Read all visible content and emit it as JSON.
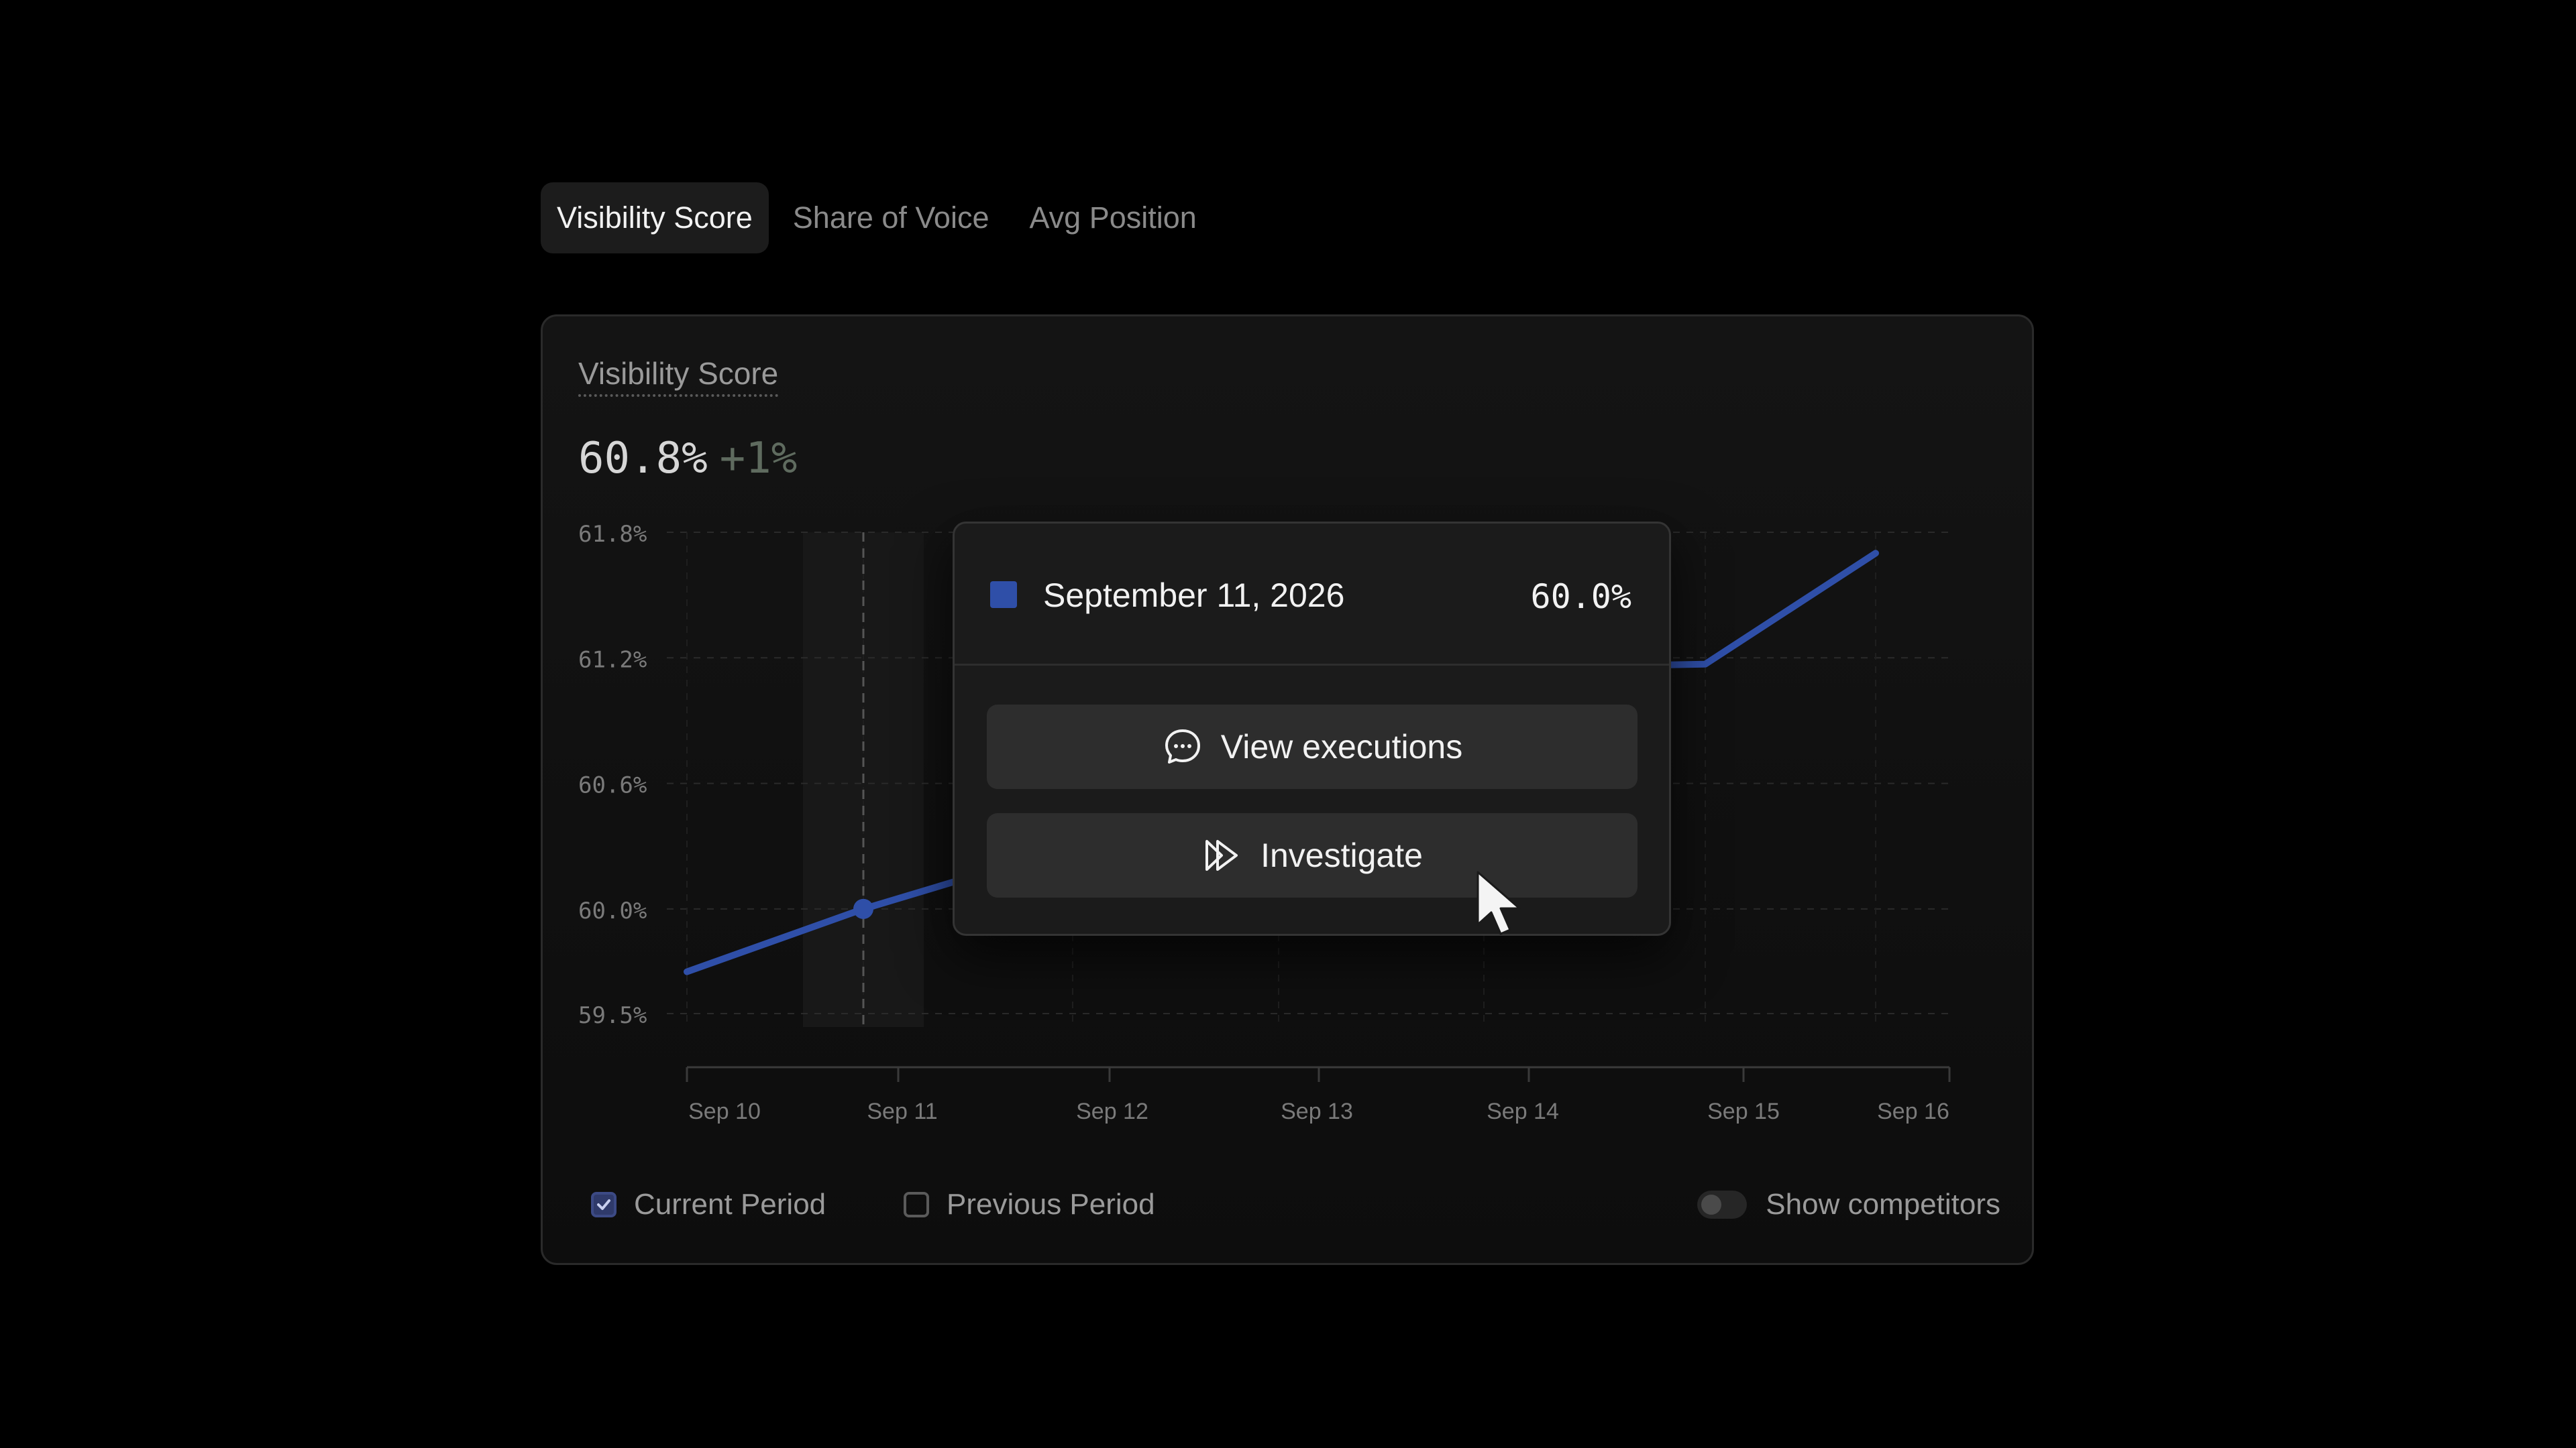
{
  "tabs": [
    {
      "label": "Visibility Score",
      "active": true
    },
    {
      "label": "Share of Voice",
      "active": false
    },
    {
      "label": "Avg Position",
      "active": false
    }
  ],
  "card": {
    "title": "Visibility Score",
    "value": "60.8%",
    "delta": "+1%"
  },
  "chart_data": {
    "type": "line",
    "categories": [
      "Sep 10",
      "Sep 11",
      "Sep 12",
      "Sep 13",
      "Sep 14",
      "Sep 15",
      "Sep 16"
    ],
    "yticks": [
      "61.8%",
      "61.2%",
      "60.6%",
      "60.0%",
      "59.5%"
    ],
    "ylim": [
      59.5,
      61.8
    ],
    "series": [
      {
        "color": "#2f4fa8",
        "x": [
          "Sep 10",
          "Sep 11",
          "Sep 12",
          "Sep 13",
          "Sep 14",
          "Sep 15",
          "Sep 16"
        ],
        "values": [
          59.7,
          60.0,
          60.3,
          60.7,
          61.15,
          61.17,
          61.7
        ]
      }
    ],
    "highlight": {
      "x": "Sep 11",
      "value": 60.0
    },
    "grid": true
  },
  "tooltip": {
    "date": "September 11, 2026",
    "value": "60.0%",
    "swatch_color": "#2f4fa8",
    "buttons": [
      {
        "label": "View executions",
        "icon": "chat-bubble-icon"
      },
      {
        "label": "Investigate",
        "icon": "fast-forward-icon"
      }
    ]
  },
  "legend": {
    "current_period": {
      "label": "Current Period",
      "checked": true
    },
    "previous_period": {
      "label": "Previous Period",
      "checked": false
    },
    "show_competitors": {
      "label": "Show competitors",
      "on": false
    }
  }
}
